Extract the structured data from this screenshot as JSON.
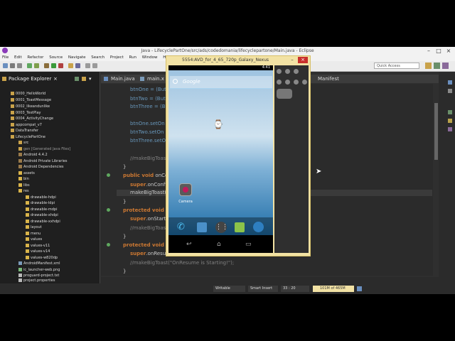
{
  "window": {
    "title": "Java - LifecyclePartOne/src/ads/codedomania/lifecyclepartone/Main.java - Eclipse",
    "minimize": "–",
    "maximize": "□",
    "close": "×"
  },
  "menu": [
    "File",
    "Edit",
    "Refactor",
    "Source",
    "Navigate",
    "Search",
    "Project",
    "Run",
    "Window",
    "Help"
  ],
  "toolbar": {
    "quick_access_placeholder": "Quick Access"
  },
  "package_explorer": {
    "title": "Package Explorer",
    "items": [
      "0000_HelloWorld",
      "0001_ToastMessage",
      "0002_likeandunlike",
      "0003_TestPlay",
      "0004_ActivityChange",
      "appcompat_v7",
      "DataTransfer",
      "LifecyclePartOne",
      "src",
      "gen [Generated Java Files]",
      "Android 4.4.2",
      "Android Private Libraries",
      "Android Dependencies",
      "assets",
      "bin",
      "libs",
      "res",
      "drawable-hdpi",
      "drawable-ldpi",
      "drawable-mdpi",
      "drawable-xhdpi",
      "drawable-xxhdpi",
      "layout",
      "menu",
      "values",
      "values-v11",
      "values-v14",
      "values-w820dp",
      "AndroidManifest.xml",
      "ic_launcher-web.png",
      "proguard-project.txt",
      "project.properties"
    ]
  },
  "editor": {
    "tabs": [
      "Main.java",
      "main.x",
      "Manifest"
    ],
    "code": {
      "l1a": "btnOne = (But",
      "l2a": "btnTwo = (But",
      "l3a": "btnThree = (B",
      "l4a": "btnOne.setOn",
      "l5a": "btnTwo.setOn",
      "l6a": "btnThree.setO",
      "l7a": "//makeBigToas",
      "l8a": "}",
      "l9kw": "public void",
      "l9b": " onCo",
      "l10kw": "super",
      "l10b": ".onConfi",
      "l11a": "makeBigToast(",
      "l12a": "}",
      "l13kw": "protected void",
      "l13b": " o",
      "l14kw": "super",
      "l14b": ".onStart(",
      "l15a": "//makeBigToas",
      "l16a": "}",
      "l17kw": "protected void",
      "l17b": " o",
      "l18kw": "super",
      "l18b": ".onResume",
      "l19a": "//makeBigToast(\"OnResume is Starting!\");",
      "l20a": "}"
    }
  },
  "status": {
    "writable": "Writable",
    "insert": "Smart Insert",
    "position": "33 : 20",
    "memory": "101M of 465M"
  },
  "emulator": {
    "title": "5554:AVD_for_4_65_720p_Galaxy_Nexus",
    "clock": "4:41",
    "search_text": "Google",
    "app_label": "Camera"
  },
  "colors": {
    "ide_background": "#2b2b2b",
    "keyword": "#cc7832",
    "field": "#6897bb",
    "emulator_frame": "#f2e2a4"
  }
}
